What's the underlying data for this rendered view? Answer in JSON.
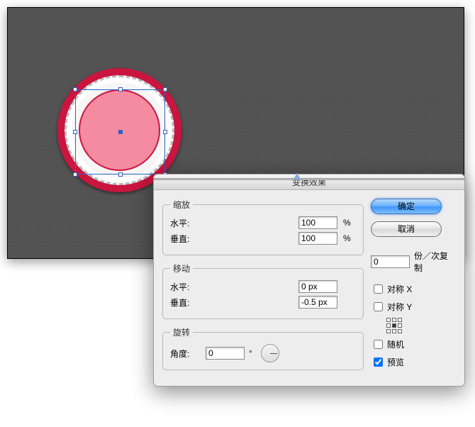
{
  "dialog": {
    "title": "变换效果",
    "scale": {
      "legend": "缩放",
      "h_label": "水平:",
      "h_value": "100",
      "h_unit": "%",
      "v_label": "垂直:",
      "v_value": "100",
      "v_unit": "%"
    },
    "move": {
      "legend": "移动",
      "h_label": "水平:",
      "h_value": "0 px",
      "v_label": "垂直:",
      "v_value": "-0.5 px"
    },
    "rotate": {
      "legend": "旋转",
      "angle_label": "角度:",
      "angle_value": "0",
      "deg": "°"
    },
    "ok_label": "确定",
    "cancel_label": "取消",
    "copies_value": "0",
    "copies_label": "份／次复制",
    "reflect_x_label": "对称 X",
    "reflect_y_label": "对称 Y",
    "random_label": "随机",
    "preview_label": "预览",
    "reflect_x": false,
    "reflect_y": false,
    "random": false,
    "preview": true
  }
}
